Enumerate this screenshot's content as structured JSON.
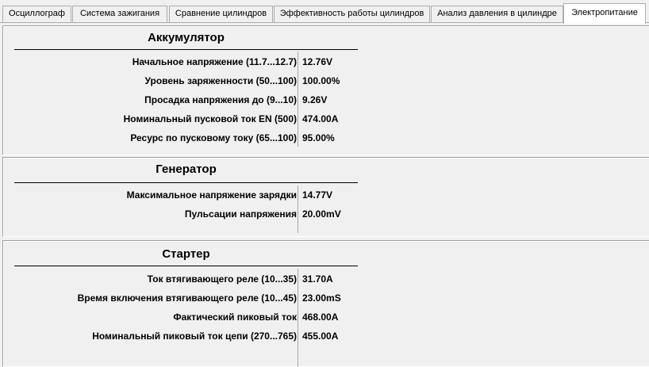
{
  "tabs": [
    {
      "label": "Осциллограф"
    },
    {
      "label": "Система зажигания"
    },
    {
      "label": "Сравнение цилиндров"
    },
    {
      "label": "Эффективность работы цилиндров"
    },
    {
      "label": "Анализ давления в цилиндре"
    },
    {
      "label": "Электропитание"
    }
  ],
  "active_tab": "Электропитание",
  "sections": {
    "battery": {
      "title": "Аккумулятор",
      "rows": [
        {
          "label": "Начальное напряжение (11.7...12.7)",
          "value": "12.76V"
        },
        {
          "label": "Уровень заряженности (50...100)",
          "value": "100.00%"
        },
        {
          "label": "Просадка напряжения до (9...10)",
          "value": "9.26V"
        },
        {
          "label": "Номинальный пусковой ток EN (500)",
          "value": "474.00A"
        },
        {
          "label": "Ресурс по пусковому току (65...100)",
          "value": "95.00%"
        }
      ]
    },
    "generator": {
      "title": "Генератор",
      "rows": [
        {
          "label": "Максимальное напряжение зарядки",
          "value": "14.77V"
        },
        {
          "label": "Пульсации напряжения",
          "value": "20.00mV"
        }
      ]
    },
    "starter": {
      "title": "Стартер",
      "rows": [
        {
          "label": "Ток втягивающего реле (10...35)",
          "value": "31.70A"
        },
        {
          "label": "Время включения втягивающего реле (10...45)",
          "value": "23.00mS"
        },
        {
          "label": "Фактический пиковый ток",
          "value": "468.00A"
        },
        {
          "label": "Номинальный пиковый ток цепи (270...765)",
          "value": "455.00A"
        }
      ]
    }
  }
}
